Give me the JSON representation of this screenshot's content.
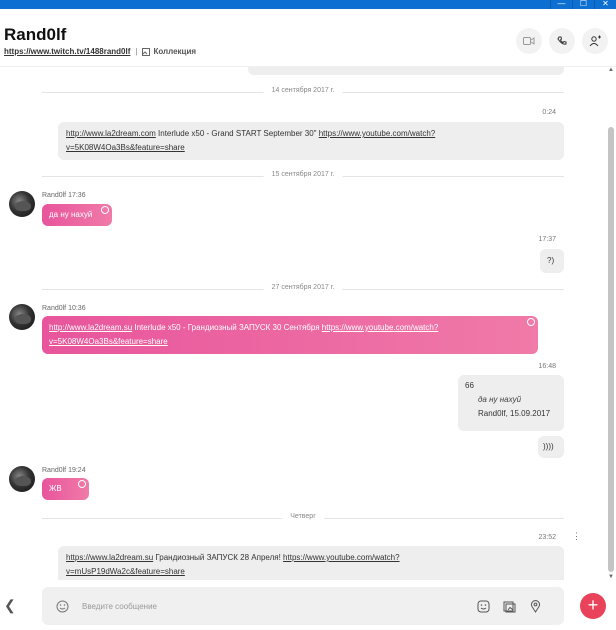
{
  "window": {
    "buttons": [
      "—",
      "☐",
      "✕"
    ]
  },
  "header": {
    "contact_name": "Rand0lf",
    "link": "https://www.twitch.tv/1488rand0lf",
    "separator": "|",
    "collection_label": "Коллекция"
  },
  "messages": {
    "sep1": "14 сентября 2017 г.",
    "time1": "0:24",
    "out1_link1": "http://www.la2dream.com",
    "out1_text": " Interlude x50 - Grand START September 30\" ",
    "out1_link2a": "https://www.youtube.com/watch?",
    "out1_link2b": "v=5K08W4Oa3Bs&feature=share",
    "sep2": "15 сентября 2017 г.",
    "in1_sender": "Rand0lf 17:36",
    "in1_text": "да ну нахуй",
    "time2": "17:37",
    "out2_text": "?)",
    "sep3": "27 сентября 2017 г.",
    "in2_sender": "Rand0lf 10:36",
    "in2_link1": "http://www.la2dream.su",
    "in2_text": " Interlude x50 - Грандиозный ЗАПУСК 30 Сентября ",
    "in2_link2a": "https://www.youtube.com/watch?",
    "in2_link2b": "v=5K08W4Oa3Bs&feature=share",
    "time3": "16:48",
    "out3_main": "66",
    "out3_quote": "да ну нахуй",
    "out3_quote_meta": "Rand0lf, 15.09.2017",
    "out4_text": "))))",
    "in3_sender": "Rand0lf 19:24",
    "in3_text": "ЖВ",
    "sep4": "Четверг",
    "time4": "23:52",
    "out5_link1": "https://www.la2dream.su",
    "out5_text": " Грандиозный ЗАПУСК 28 Апреля! ",
    "out5_link2a": "https://www.youtube.com/watch?",
    "out5_link2b": "v=mUsP19dWa2c&feature=share"
  },
  "input": {
    "placeholder": "Введите сообщение"
  },
  "colors": {
    "accent": "#e8559c",
    "plus": "#e8435a",
    "titlebar": "#0d6fd1"
  }
}
